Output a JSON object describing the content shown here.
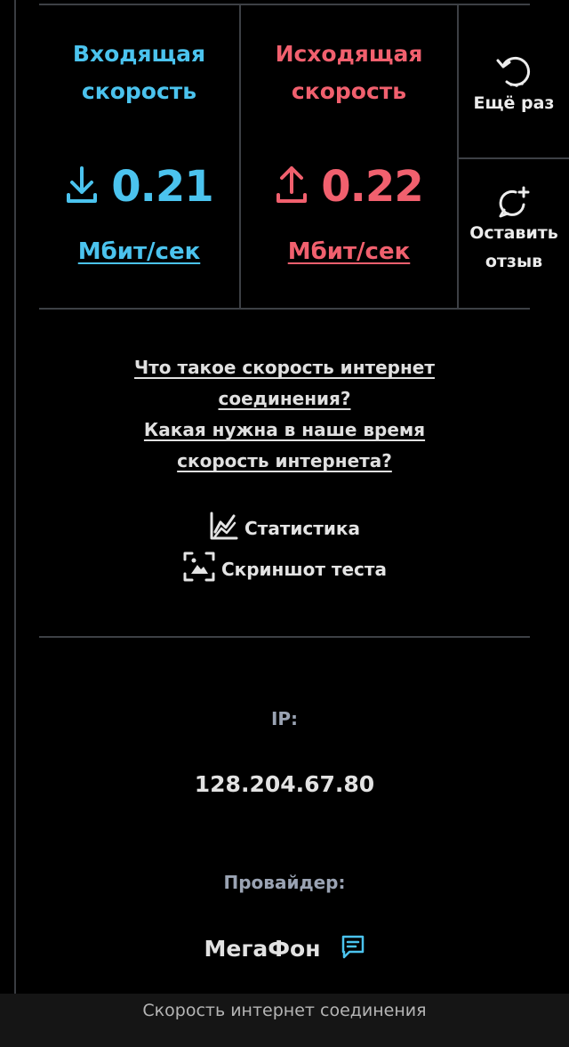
{
  "download": {
    "title_line1": "Входящая",
    "title_line2": "скорость",
    "value": "0.21",
    "unit": "Мбит/сек",
    "color": "#4bc3ee"
  },
  "upload": {
    "title_line1": "Исходящая",
    "title_line2": "скорость",
    "value": "0.22",
    "unit": "Мбит/сек",
    "color": "#f1606e"
  },
  "side": {
    "retry_label": "Ещё раз",
    "feedback_line1": "Оставить",
    "feedback_line2": "отзыв"
  },
  "links": {
    "q1_line1": "Что такое скорость интернет",
    "q1_line2": "соединения?",
    "q2_line1": "Какая нужна в наше время",
    "q2_line2": "скорость интернета?"
  },
  "actions": {
    "statistics": "Статистика",
    "screenshot": "Скриншот теста"
  },
  "info": {
    "ip_label": "IP:",
    "ip_value": "128.204.67.80",
    "provider_label": "Провайдер:",
    "provider_value": "МегаФон"
  },
  "bottom_bar": {
    "title": "Скорость интернет соединения"
  },
  "icons": {
    "download": "download-arrow-icon",
    "upload": "upload-arrow-icon",
    "retry": "refresh-icon",
    "feedback": "chat-plus-icon",
    "statistics": "chart-icon",
    "screenshot": "screenshot-icon",
    "provider_comment": "comment-icon"
  }
}
